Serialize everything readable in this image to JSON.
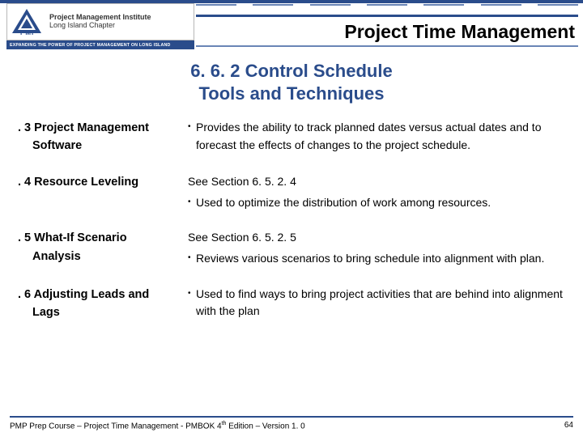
{
  "header": {
    "org_line1": "Project Management Institute",
    "org_line2": "Long Island Chapter",
    "pmi_abbrev": "PMI",
    "tagline": "EXPANDING THE POWER OF PROJECT MANAGEMENT ON LONG ISLAND",
    "page_title": "Project Time Management"
  },
  "section": {
    "line1": "6. 6. 2 Control Schedule",
    "line2": "Tools and Techniques"
  },
  "rows": [
    {
      "num": ". 3",
      "label_l1": "Project Management",
      "label_l2": "Software",
      "see": "",
      "bullet": "Provides the ability to track planned dates versus actual dates and to forecast the effects of changes to the project schedule."
    },
    {
      "num": ". 4",
      "label_l1": "Resource Leveling",
      "label_l2": "",
      "see": "See Section 6. 5. 2. 4",
      "bullet": "Used to optimize the distribution of work among resources."
    },
    {
      "num": ". 5",
      "label_l1": "What-If Scenario",
      "label_l2": "Analysis",
      "see": "See Section 6. 5. 2. 5",
      "bullet": "Reviews various scenarios to bring schedule into alignment with plan."
    },
    {
      "num": ". 6",
      "label_l1": "Adjusting Leads and",
      "label_l2": "Lags",
      "see": "",
      "bullet": "Used to find ways to bring project activities that are behind into alignment with the plan"
    }
  ],
  "footer": {
    "left_a": "PMP Prep Course – Project Time Management - PMBOK 4",
    "left_sup": "th",
    "left_b": " Edition – Version 1. 0",
    "page_num": "64"
  }
}
